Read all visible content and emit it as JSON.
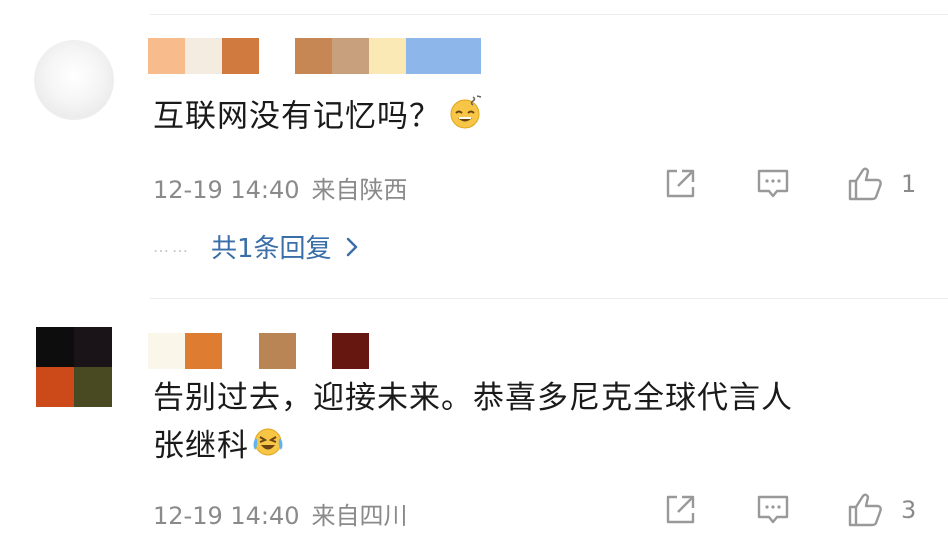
{
  "comments": [
    {
      "content": "互联网没有记忆吗？",
      "emoji": "grinning-sweat-emoji",
      "time": "12-19 14:40",
      "location": "来自陕西",
      "likes": "1",
      "replies_label": "共1条回复",
      "replies_dots": "……",
      "username_mosaic_colors": [
        "#f7bb8c",
        "#f4ece0",
        "#d07a3f",
        "#ffffff",
        "#c68755",
        "#c9a07e",
        "#fbe9b5",
        "#8db6ea"
      ]
    },
    {
      "content_line1": "告别过去，迎接未来。恭喜多尼克全球代言人",
      "content_line2": "张继科",
      "emoji": "crying-laughing-emoji",
      "time": "12-19 14:40",
      "location": "来自四川",
      "likes": "3",
      "username_mosaic_colors": [
        "#fbf6ea",
        "#de7d31",
        "#ffffff",
        "#b98555",
        "#ffffff",
        "#661710"
      ],
      "avatar_colors": [
        "#0d0d0d",
        "#1a1418",
        "#cc4a1a",
        "#4a4a22"
      ]
    }
  ],
  "icons": {
    "share": "share-icon",
    "comment": "comment-icon",
    "like": "thumbs-up-icon",
    "chevron": "chevron-right-icon"
  },
  "colors": {
    "link": "#3a6ea8",
    "meta": "#8a8a8a",
    "divider": "#ececec"
  }
}
